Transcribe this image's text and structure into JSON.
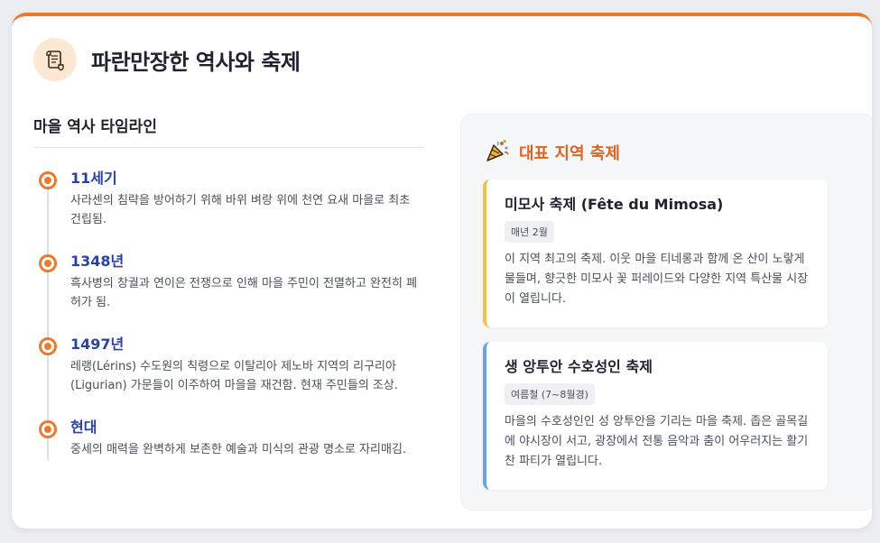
{
  "header": {
    "title": "파란만장한 역사와 축제",
    "icon": "scroll-icon"
  },
  "timeline": {
    "title": "마을 역사 타임라인",
    "items": [
      {
        "year": "11세기",
        "desc": "사라센의 침략을 방어하기 위해 바위 벼랑 위에 천연 요새 마을로 최초 건립됨."
      },
      {
        "year": "1348년",
        "desc": "흑사병의 창궐과 연이은 전쟁으로 인해 마을 주민이 전멸하고 완전히 폐허가 됨."
      },
      {
        "year": "1497년",
        "desc": "레랭(Lérins) 수도원의 칙령으로 이탈리아 제노바 지역의 리구리아(Ligurian) 가문들이 이주하여 마을을 재건함. 현재 주민들의 조상."
      },
      {
        "year": "현대",
        "desc": "중세의 매력을 완벽하게 보존한 예술과 미식의 관광 명소로 자리매김."
      }
    ]
  },
  "festivals": {
    "title": "대표 지역 축제",
    "icon": "party-popper-icon",
    "accent": "#e0641e",
    "items": [
      {
        "name": "미모사 축제 (Fête du Mimosa)",
        "badge": "매년 2월",
        "desc": "이 지역 최고의 축제. 이웃 마을 티네롱과 함께 온 산이 노랗게 물들며, 향긋한 미모사 꽃 퍼레이드와 다양한 지역 특산물 시장이 열립니다.",
        "color": "#f2c14a"
      },
      {
        "name": "생 앙투안 수호성인 축제",
        "badge": "여름철 (7~8월경)",
        "desc": "마을의 수호성인인 성 앙투안을 기리는 마을 축제. 좁은 골목길에 야시장이 서고, 광장에서 전통 음악과 춤이 어우러지는 활기찬 파티가 열립니다.",
        "color": "#6aa2e8"
      }
    ]
  }
}
